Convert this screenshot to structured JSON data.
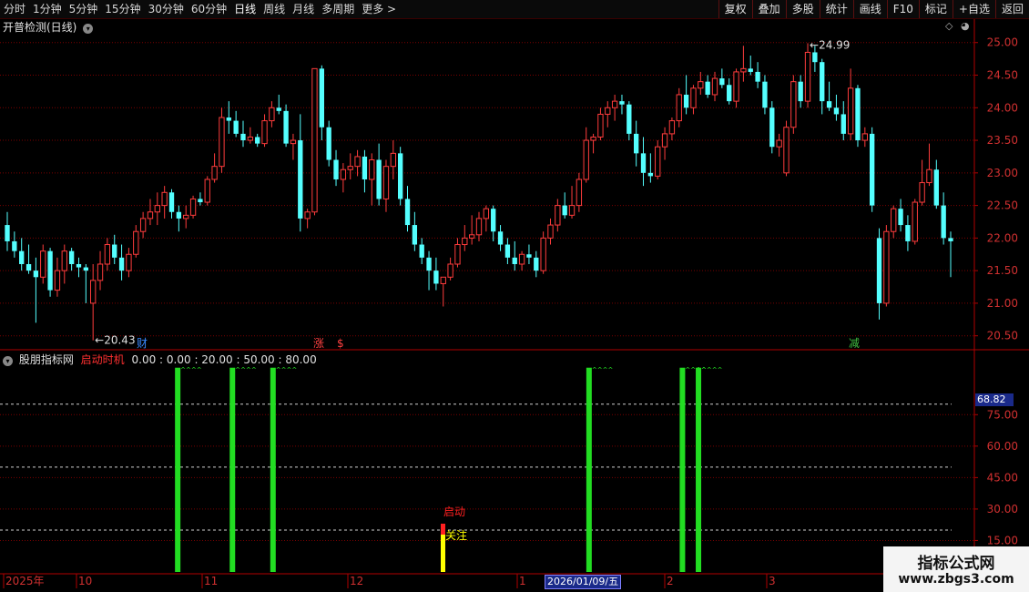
{
  "toolbar": {
    "periods": [
      "分时",
      "1分钟",
      "5分钟",
      "15分钟",
      "30分钟",
      "60分钟",
      "日线",
      "周线",
      "月线",
      "多周期",
      "更多 >"
    ],
    "active_period": "日线",
    "right_buttons": [
      "复权",
      "叠加",
      "多股",
      "统计",
      "画线",
      "F10",
      "标记",
      "+自选",
      "返回"
    ]
  },
  "main_panel": {
    "title": "开普检测(日线)",
    "high_label": "24.99",
    "low_label": "20.43",
    "markers": [
      {
        "text": "财",
        "color": "#3a8aff"
      },
      {
        "text": "涨",
        "color": "#ff4040"
      },
      {
        "text": "$",
        "color": "#ff4040"
      },
      {
        "text": "减",
        "color": "#40c040"
      }
    ],
    "y_ticks": [
      "25.00",
      "24.50",
      "24.00",
      "23.50",
      "23.00",
      "22.50",
      "22.00",
      "21.50",
      "21.00",
      "20.50"
    ]
  },
  "indicator_panel": {
    "name": "股朋指标网",
    "indicator": "启动时机",
    "params": "0.00 : 0.00 : 20.00 : 50.00 : 80.00",
    "y_ticks": [
      "75.00",
      "60.00",
      "45.00",
      "30.00",
      "15.00"
    ],
    "current_value": "68.82",
    "signal_labels": {
      "start": "启动",
      "watch": "关注"
    },
    "bar_top_label": "^^^^"
  },
  "time_axis": {
    "labels": [
      "2025年",
      "10",
      "11",
      "12",
      "1",
      "2",
      "3"
    ],
    "cursor_date": "2026/01/09/五"
  },
  "watermark": {
    "line1": "指标公式网",
    "line2": "www.zbgs3.com"
  },
  "colors": {
    "up": "#ff3c3c",
    "down": "#54ffff",
    "grid": "#7a0000",
    "signal": "#22dd22",
    "start": "#ff2020",
    "watch": "#ffff00"
  },
  "chart_data": {
    "type": "candlestick",
    "price_range": [
      20.3,
      25.15
    ],
    "indicator_range": [
      0,
      100
    ],
    "signal_bars_positions": [
      0.171,
      0.229,
      0.272,
      0.607,
      0.706,
      0.723
    ],
    "ohlc_note": "daily candles Sep 2025 – Mar 2026",
    "ohlc": [
      [
        22.2,
        22.4,
        21.8,
        21.95
      ],
      [
        21.95,
        22.1,
        21.7,
        21.8
      ],
      [
        21.8,
        22.0,
        21.5,
        21.6
      ],
      [
        21.6,
        21.9,
        21.45,
        21.5
      ],
      [
        21.5,
        21.7,
        20.7,
        21.4
      ],
      [
        21.4,
        21.9,
        21.3,
        21.8
      ],
      [
        21.8,
        21.85,
        21.1,
        21.2
      ],
      [
        21.2,
        21.7,
        21.1,
        21.5
      ],
      [
        21.5,
        21.9,
        21.3,
        21.8
      ],
      [
        21.8,
        21.85,
        21.5,
        21.6
      ],
      [
        21.6,
        21.7,
        21.4,
        21.55
      ],
      [
        21.55,
        21.6,
        21.0,
        21.5
      ],
      [
        21.0,
        21.6,
        20.43,
        21.35
      ],
      [
        21.35,
        21.8,
        21.2,
        21.6
      ],
      [
        21.6,
        22.0,
        21.5,
        21.9
      ],
      [
        21.9,
        22.05,
        21.6,
        21.7
      ],
      [
        21.7,
        21.9,
        21.35,
        21.5
      ],
      [
        21.5,
        21.85,
        21.4,
        21.75
      ],
      [
        21.75,
        22.2,
        21.7,
        22.1
      ],
      [
        22.1,
        22.4,
        22.0,
        22.3
      ],
      [
        22.3,
        22.6,
        22.2,
        22.4
      ],
      [
        22.4,
        22.7,
        22.2,
        22.5
      ],
      [
        22.5,
        22.8,
        22.3,
        22.7
      ],
      [
        22.7,
        22.75,
        22.3,
        22.4
      ],
      [
        22.4,
        22.5,
        22.1,
        22.3
      ],
      [
        22.3,
        22.5,
        22.15,
        22.35
      ],
      [
        22.35,
        22.65,
        22.3,
        22.6
      ],
      [
        22.6,
        22.7,
        22.5,
        22.55
      ],
      [
        22.55,
        22.95,
        22.5,
        22.9
      ],
      [
        22.9,
        23.3,
        22.85,
        23.1
      ],
      [
        23.1,
        24.0,
        23.0,
        23.85
      ],
      [
        23.85,
        24.1,
        23.6,
        23.8
      ],
      [
        23.8,
        23.95,
        23.55,
        23.6
      ],
      [
        23.6,
        23.8,
        23.4,
        23.5
      ],
      [
        23.5,
        23.7,
        23.45,
        23.55
      ],
      [
        23.55,
        23.6,
        23.4,
        23.45
      ],
      [
        23.45,
        23.9,
        23.4,
        23.8
      ],
      [
        23.8,
        24.1,
        23.7,
        24.0
      ],
      [
        24.0,
        24.2,
        23.9,
        23.95
      ],
      [
        23.95,
        24.05,
        23.4,
        23.45
      ],
      [
        23.45,
        23.6,
        23.2,
        23.5
      ],
      [
        23.5,
        23.9,
        22.1,
        22.3
      ],
      [
        22.3,
        22.45,
        22.15,
        22.4
      ],
      [
        22.4,
        24.6,
        22.35,
        24.6
      ],
      [
        24.6,
        24.65,
        23.5,
        23.7
      ],
      [
        23.7,
        23.8,
        23.1,
        23.2
      ],
      [
        23.2,
        23.35,
        22.8,
        22.9
      ],
      [
        22.9,
        23.15,
        22.7,
        23.05
      ],
      [
        23.05,
        23.3,
        22.9,
        23.1
      ],
      [
        23.1,
        23.35,
        22.95,
        23.25
      ],
      [
        23.25,
        23.35,
        22.7,
        22.9
      ],
      [
        22.9,
        23.3,
        22.5,
        23.2
      ],
      [
        23.2,
        23.45,
        22.5,
        22.6
      ],
      [
        22.6,
        23.2,
        22.4,
        23.1
      ],
      [
        23.1,
        23.5,
        22.9,
        23.3
      ],
      [
        23.3,
        23.4,
        22.5,
        22.6
      ],
      [
        22.6,
        22.8,
        22.1,
        22.2
      ],
      [
        22.2,
        22.4,
        21.8,
        21.9
      ],
      [
        21.9,
        22.0,
        21.6,
        21.7
      ],
      [
        21.7,
        21.8,
        21.2,
        21.5
      ],
      [
        21.5,
        21.7,
        21.2,
        21.3
      ],
      [
        21.3,
        21.4,
        20.95,
        21.4
      ],
      [
        21.4,
        21.7,
        21.35,
        21.6
      ],
      [
        21.6,
        22.0,
        21.55,
        21.9
      ],
      [
        21.9,
        22.2,
        21.8,
        22.0
      ],
      [
        22.0,
        22.35,
        21.9,
        22.05
      ],
      [
        22.05,
        22.4,
        21.95,
        22.3
      ],
      [
        22.3,
        22.5,
        22.1,
        22.45
      ],
      [
        22.45,
        22.5,
        21.95,
        22.1
      ],
      [
        22.1,
        22.2,
        21.8,
        21.9
      ],
      [
        21.9,
        22.0,
        21.6,
        21.7
      ],
      [
        21.7,
        21.95,
        21.5,
        21.6
      ],
      [
        21.6,
        21.8,
        21.5,
        21.75
      ],
      [
        21.75,
        21.9,
        21.6,
        21.7
      ],
      [
        21.7,
        21.8,
        21.4,
        21.5
      ],
      [
        21.5,
        22.1,
        21.45,
        22.0
      ],
      [
        22.0,
        22.3,
        21.9,
        22.2
      ],
      [
        22.2,
        22.6,
        22.1,
        22.5
      ],
      [
        22.5,
        22.7,
        22.3,
        22.35
      ],
      [
        22.35,
        22.8,
        22.3,
        22.5
      ],
      [
        22.5,
        23.0,
        22.4,
        22.9
      ],
      [
        22.9,
        23.7,
        22.85,
        23.5
      ],
      [
        23.5,
        23.6,
        23.3,
        23.55
      ],
      [
        23.55,
        24.0,
        23.5,
        23.9
      ],
      [
        23.9,
        24.1,
        23.7,
        24.0
      ],
      [
        24.0,
        24.2,
        23.8,
        24.1
      ],
      [
        24.1,
        24.2,
        23.9,
        24.05
      ],
      [
        24.05,
        24.1,
        23.5,
        23.6
      ],
      [
        23.6,
        23.8,
        23.1,
        23.3
      ],
      [
        23.3,
        23.55,
        22.8,
        23.0
      ],
      [
        23.0,
        23.3,
        22.85,
        22.95
      ],
      [
        22.95,
        23.5,
        22.9,
        23.4
      ],
      [
        23.4,
        23.7,
        23.2,
        23.6
      ],
      [
        23.6,
        23.85,
        23.5,
        23.8
      ],
      [
        23.8,
        24.3,
        23.7,
        24.2
      ],
      [
        24.2,
        24.5,
        23.9,
        24.0
      ],
      [
        24.0,
        24.35,
        23.9,
        24.3
      ],
      [
        24.3,
        24.55,
        24.2,
        24.4
      ],
      [
        24.4,
        24.5,
        24.15,
        24.2
      ],
      [
        24.2,
        24.55,
        24.1,
        24.45
      ],
      [
        24.45,
        24.6,
        24.3,
        24.35
      ],
      [
        24.35,
        24.45,
        24.05,
        24.1
      ],
      [
        24.1,
        24.6,
        24.0,
        24.55
      ],
      [
        24.55,
        24.95,
        24.4,
        24.6
      ],
      [
        24.6,
        24.8,
        24.5,
        24.55
      ],
      [
        24.55,
        24.7,
        24.3,
        24.4
      ],
      [
        24.4,
        24.5,
        23.9,
        24.0
      ],
      [
        24.0,
        24.1,
        23.3,
        23.4
      ],
      [
        23.4,
        23.6,
        23.25,
        23.5
      ],
      [
        23.0,
        23.8,
        22.95,
        23.7
      ],
      [
        23.7,
        24.5,
        23.6,
        24.4
      ],
      [
        24.4,
        24.5,
        24.0,
        24.1
      ],
      [
        24.1,
        24.99,
        24.0,
        24.85
      ],
      [
        24.85,
        24.95,
        24.55,
        24.7
      ],
      [
        24.7,
        24.75,
        23.9,
        24.1
      ],
      [
        24.1,
        24.4,
        23.95,
        24.0
      ],
      [
        24.0,
        24.2,
        23.8,
        23.9
      ],
      [
        23.9,
        24.1,
        23.5,
        23.6
      ],
      [
        23.6,
        24.6,
        23.5,
        24.3
      ],
      [
        24.3,
        24.35,
        23.4,
        23.5
      ],
      [
        23.5,
        23.7,
        23.4,
        23.6
      ],
      [
        23.6,
        23.7,
        22.4,
        22.5
      ],
      [
        22.0,
        22.15,
        20.75,
        21.0
      ],
      [
        21.0,
        22.2,
        20.95,
        22.1
      ],
      [
        22.1,
        22.5,
        22.0,
        22.45
      ],
      [
        22.45,
        22.6,
        22.1,
        22.2
      ],
      [
        22.2,
        22.35,
        21.8,
        21.95
      ],
      [
        21.95,
        22.6,
        21.9,
        22.55
      ],
      [
        22.55,
        23.2,
        22.5,
        22.85
      ],
      [
        22.85,
        23.45,
        22.8,
        23.05
      ],
      [
        23.05,
        23.2,
        22.45,
        22.5
      ],
      [
        22.5,
        22.7,
        21.9,
        22.0
      ],
      [
        22.0,
        22.1,
        21.4,
        21.95
      ]
    ]
  }
}
